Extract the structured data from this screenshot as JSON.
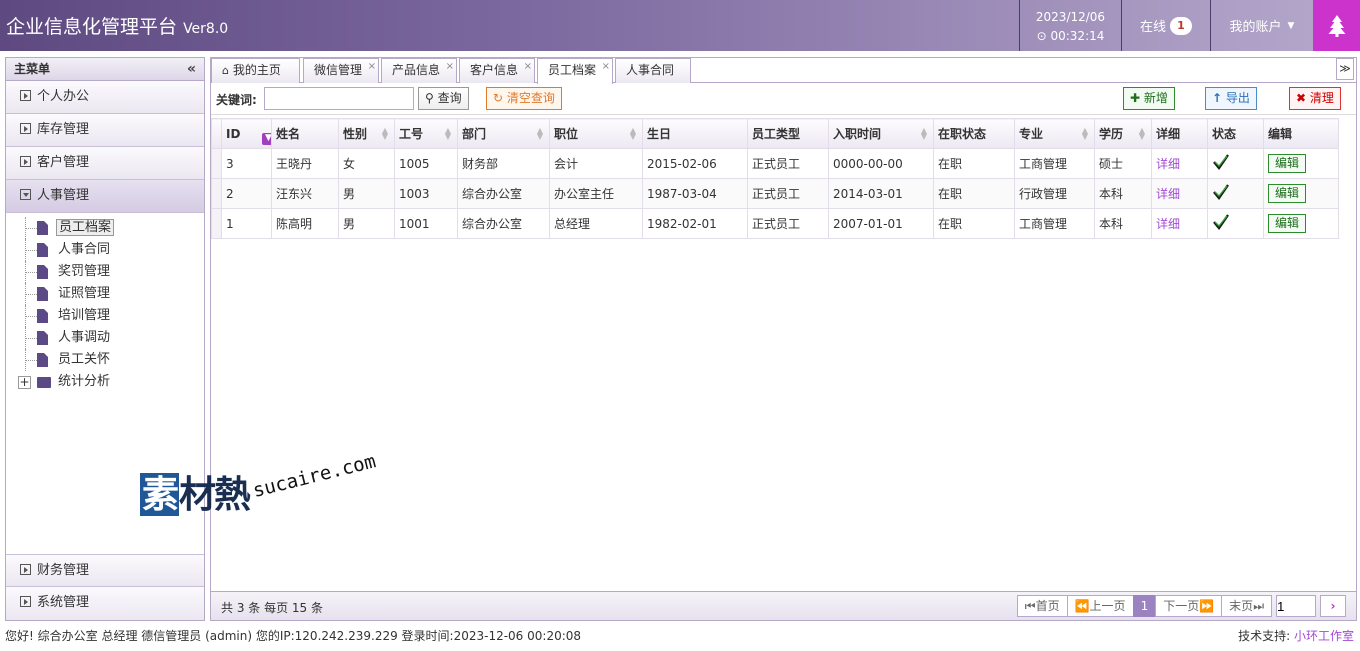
{
  "header": {
    "app_title": "企业信息化管理平台",
    "version": "Ver8.0",
    "date": "2023/12/06",
    "time": "00:32:14",
    "online_label": "在线",
    "online_count": "1",
    "account_label": "我的账户"
  },
  "sidebar": {
    "title": "主菜单",
    "collapse_icon": "«",
    "menus_top": [
      {
        "label": "个人办公"
      },
      {
        "label": "库存管理"
      },
      {
        "label": "客户管理"
      },
      {
        "label": "人事管理"
      }
    ],
    "tree_items": [
      {
        "label": "员工档案"
      },
      {
        "label": "人事合同"
      },
      {
        "label": "奖罚管理"
      },
      {
        "label": "证照管理"
      },
      {
        "label": "培训管理"
      },
      {
        "label": "人事调动"
      },
      {
        "label": "员工关怀"
      },
      {
        "label": "统计分析"
      }
    ],
    "menus_bottom": [
      {
        "label": "财务管理"
      },
      {
        "label": "系统管理"
      }
    ]
  },
  "tabs": [
    {
      "label": "我的主页"
    },
    {
      "label": "微信管理"
    },
    {
      "label": "产品信息"
    },
    {
      "label": "客户信息"
    },
    {
      "label": "员工档案"
    },
    {
      "label": "人事合同"
    }
  ],
  "toolbar": {
    "keyword_label": "关键词:",
    "keyword_value": "",
    "search_label": "查询",
    "clear_label": "清空查询",
    "add_label": "新增",
    "export_label": "导出",
    "purge_label": "清理"
  },
  "table": {
    "columns": [
      "ID",
      "姓名",
      "性别",
      "工号",
      "部门",
      "职位",
      "生日",
      "员工类型",
      "入职时间",
      "在职状态",
      "专业",
      "学历",
      "详细",
      "状态",
      "编辑"
    ],
    "rows": [
      {
        "id": "3",
        "name": "王晓丹",
        "gender": "女",
        "no": "1005",
        "dept": "财务部",
        "pos": "会计",
        "birth": "2015-02-06",
        "type": "正式员工",
        "hire": "0000-00-00",
        "status": "在职",
        "major": "工商管理",
        "edu": "硕士",
        "detail": "详细",
        "edit": "编辑"
      },
      {
        "id": "2",
        "name": "汪东兴",
        "gender": "男",
        "no": "1003",
        "dept": "综合办公室",
        "pos": "办公室主任",
        "birth": "1987-03-04",
        "type": "正式员工",
        "hire": "2014-03-01",
        "status": "在职",
        "major": "行政管理",
        "edu": "本科",
        "detail": "详细",
        "edit": "编辑"
      },
      {
        "id": "1",
        "name": "陈高明",
        "gender": "男",
        "no": "1001",
        "dept": "综合办公室",
        "pos": "总经理",
        "birth": "1982-02-01",
        "type": "正式员工",
        "hire": "2007-01-01",
        "status": "在职",
        "major": "工商管理",
        "edu": "本科",
        "detail": "详细",
        "edit": "编辑"
      }
    ]
  },
  "pager": {
    "summary": "共 3 条 每页 15 条",
    "first": "首页",
    "prev": "上一页",
    "current": "1",
    "next": "下一页",
    "last": "末页",
    "page_input": "1"
  },
  "status_bar": {
    "left": "您好! 综合办公室 总经理 德信管理员 (admin) 您的IP:120.242.239.229 登录时间:2023-12-06 00:20:08",
    "support_label": "技术支持:",
    "support_link": "小环工作室"
  },
  "watermark": {
    "logo_first": "素",
    "logo_rest": "材熱",
    "url": "sucaire.com"
  },
  "colors": {
    "header_start": "#5e4a80",
    "accent_pink": "#cc33cc",
    "link_purple": "#a34ad6"
  }
}
